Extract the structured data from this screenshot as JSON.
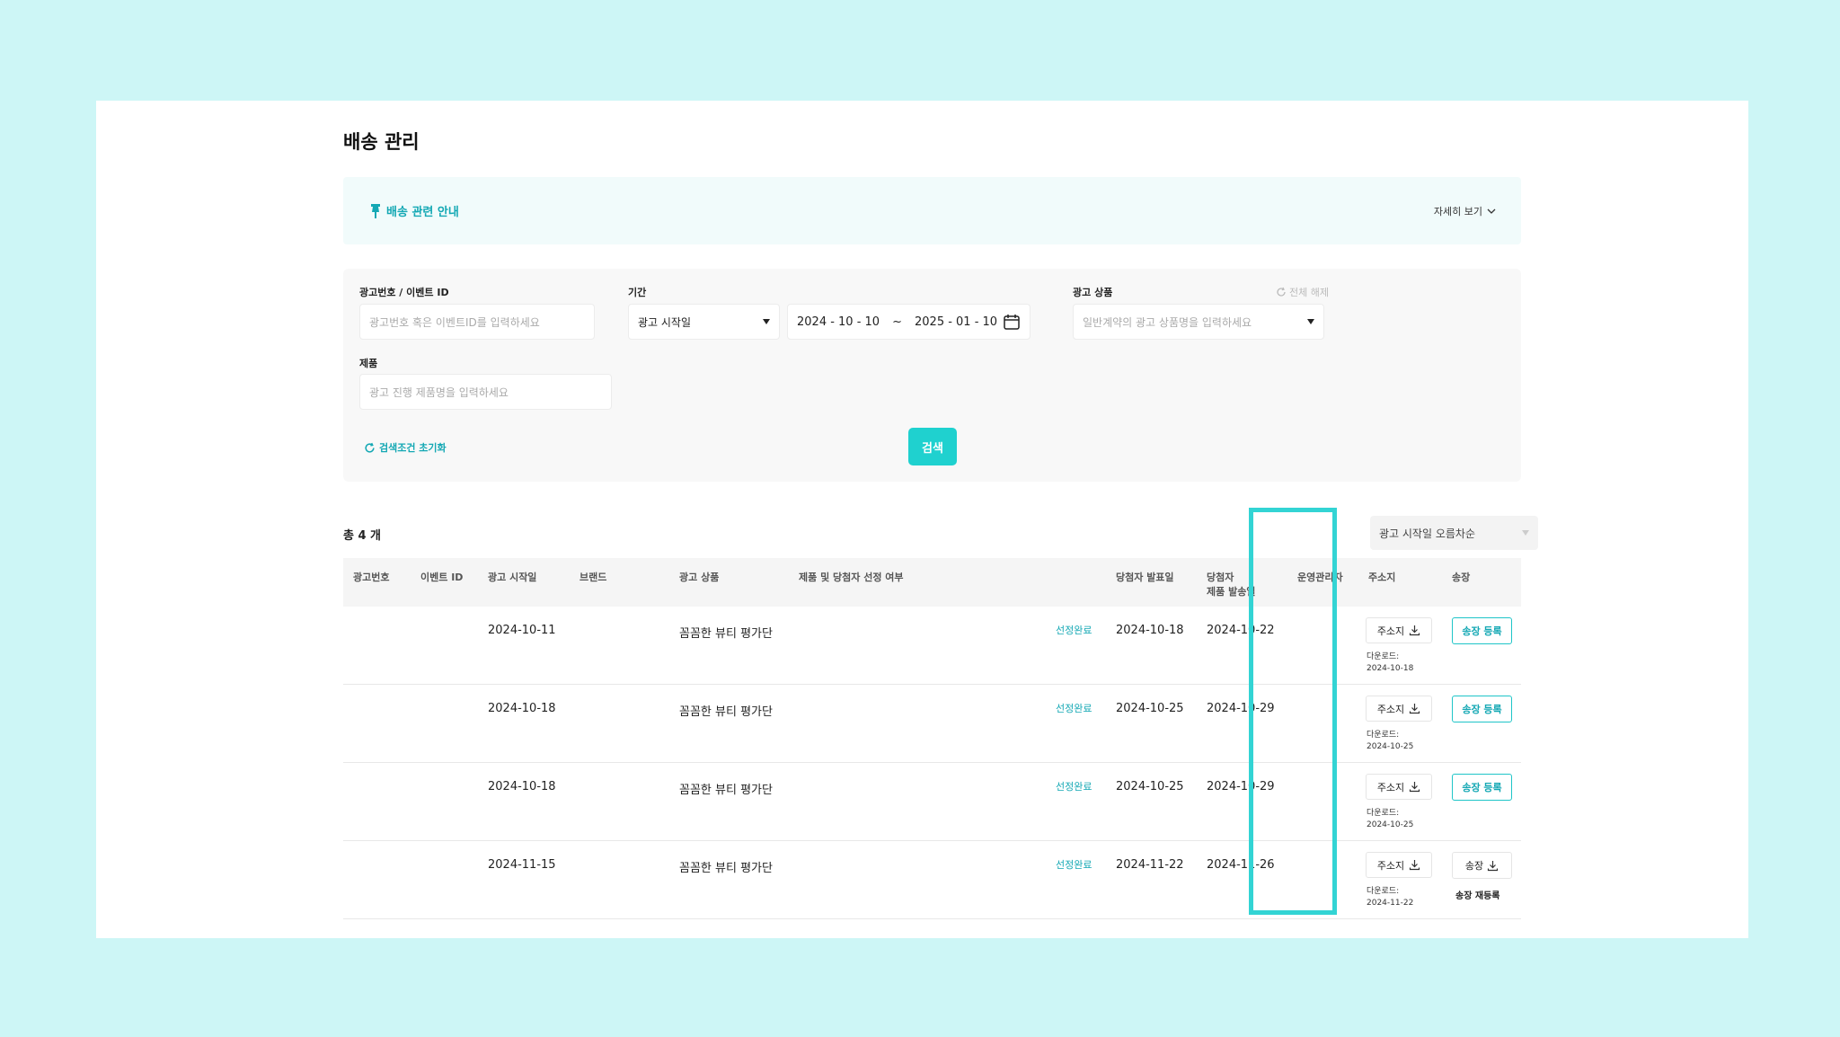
{
  "page": {
    "title": "배송 관리"
  },
  "notice": {
    "title": "배송 관련 안내",
    "detail_label": "자세히 보기"
  },
  "filter": {
    "ad_id_label": "광고번호 / 이벤트 ID",
    "ad_id_placeholder": "광고번호 혹은 이벤트ID를 입력하세요",
    "period_label": "기간",
    "period_type": "광고 시작일",
    "date_from": "2024 - 10 - 10",
    "date_sep": "~",
    "date_to": "2025 - 01 - 10",
    "product_label": "광고 상품",
    "product_placeholder": "일반계약의 광고 상품명을 입력하세요",
    "clear_all": "전체 해제",
    "item_label": "제품",
    "item_placeholder": "광고 진행 제품명을 입력하세요",
    "reset_label": "검색조건 초기화",
    "search_label": "검색"
  },
  "results": {
    "total": "총 4 개",
    "sort": "광고 시작일 오름차순"
  },
  "table": {
    "headers": {
      "ad_no": "광고번호",
      "event_id": "이벤트 ID",
      "start_date": "광고 시작일",
      "brand": "브랜드",
      "ad_product": "광고 상품",
      "selection": "제품 및 당첨자 선정 여부",
      "announce": "당첨자 발표일",
      "ship_line1": "당첨자",
      "ship_line2": "제품 발송일",
      "manager": "운영관리자",
      "address": "주소지",
      "invoice": "송장"
    },
    "rows": [
      {
        "start": "2024-10-11",
        "product": "꼼꼼한 뷰티 평가단",
        "status": "선정완료",
        "announce": "2024-10-18",
        "ship": "2024-10-22",
        "addr_btn": "주소지",
        "dl_label": "다운로드:",
        "dl_date": "2024-10-18",
        "invoice_btn": "송장 등록"
      },
      {
        "start": "2024-10-18",
        "product": "꼼꼼한 뷰티 평가단",
        "status": "선정완료",
        "announce": "2024-10-25",
        "ship": "2024-10-29",
        "addr_btn": "주소지",
        "dl_label": "다운로드:",
        "dl_date": "2024-10-25",
        "invoice_btn": "송장 등록"
      },
      {
        "start": "2024-10-18",
        "product": "꼼꼼한 뷰티 평가단",
        "status": "선정완료",
        "announce": "2024-10-25",
        "ship": "2024-10-29",
        "addr_btn": "주소지",
        "dl_label": "다운로드:",
        "dl_date": "2024-10-25",
        "invoice_btn": "송장 등록"
      },
      {
        "start": "2024-11-15",
        "product": "꼼꼼한 뷰티 평가단",
        "status": "선정완료",
        "announce": "2024-11-22",
        "ship": "2024-11-26",
        "addr_btn": "주소지",
        "dl_label": "다운로드:",
        "dl_date": "2024-11-22",
        "invoice_btn": "송장",
        "reregister": "송장 재등록"
      }
    ]
  },
  "colors": {
    "accent": "#1fd1cf",
    "accent_text": "#14a8b4",
    "highlight": "#33d4d4",
    "background": "#cdf6f6"
  }
}
